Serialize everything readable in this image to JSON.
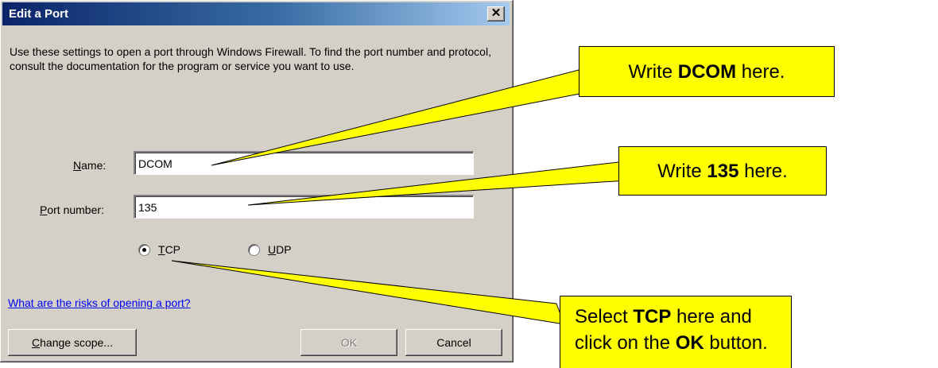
{
  "dialog": {
    "title": "Edit a Port",
    "close_glyph": "✕",
    "description": "Use these settings to open a port through Windows Firewall. To find the port number and protocol, consult the documentation for the program or service you want to use.",
    "name_label_u": "N",
    "name_label_rest": "ame:",
    "name_value": "DCOM",
    "port_label_u": "P",
    "port_label_rest": "ort number:",
    "port_value": "135",
    "tcp_u": "T",
    "tcp_rest": "CP",
    "udp_u": "U",
    "udp_rest": "DP",
    "selected_protocol": "TCP",
    "risk_link": "What are the risks of opening a port?",
    "change_scope_u": "C",
    "change_scope_rest": "hange scope...",
    "ok_label": "OK",
    "cancel_label": "Cancel"
  },
  "callouts": {
    "name": {
      "pre": "Write ",
      "bold": "DCOM",
      "post": " here."
    },
    "port": {
      "pre": "Write ",
      "bold": "135",
      "post": " here."
    },
    "tcp": {
      "pre": "Select ",
      "bold": "TCP",
      "mid": " here and click on the ",
      "bold2": "OK",
      "post": " button."
    }
  },
  "colors": {
    "callout_fill": "#ffff00",
    "dialog_face": "#d4d0c8",
    "titlebar": "#0a246a"
  }
}
